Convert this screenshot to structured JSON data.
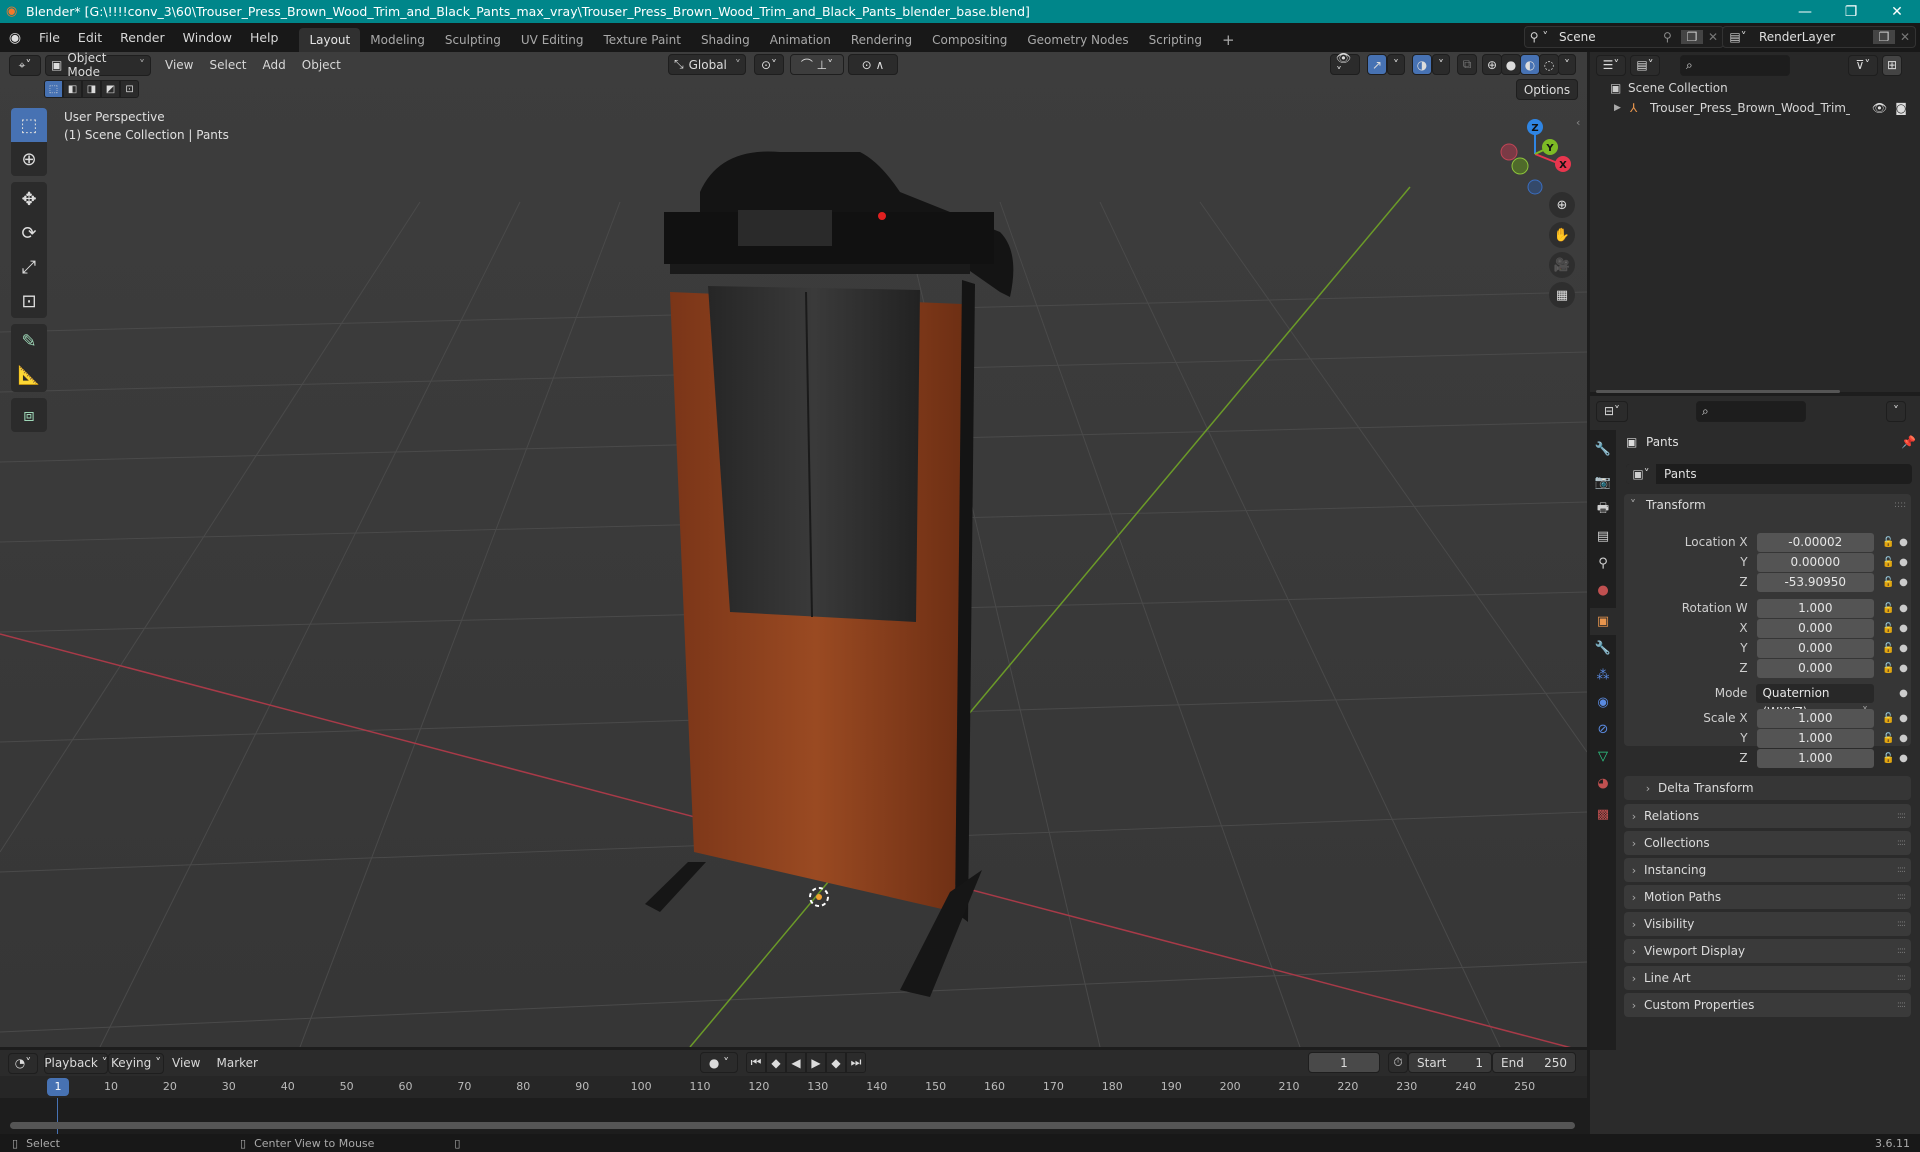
{
  "window": {
    "title": "Blender* [G:\\!!!!conv_3\\60\\Trouser_Press_Brown_Wood_Trim_and_Black_Pants_max_vray\\Trouser_Press_Brown_Wood_Trim_and_Black_Pants_blender_base.blend]",
    "minimize_icon": "—",
    "maximize_icon": "❐",
    "close_icon": "✕"
  },
  "menu": [
    "File",
    "Edit",
    "Render",
    "Window",
    "Help"
  ],
  "workspace_tabs": [
    {
      "label": "Layout",
      "active": true
    },
    {
      "label": "Modeling"
    },
    {
      "label": "Sculpting"
    },
    {
      "label": "UV Editing"
    },
    {
      "label": "Texture Paint"
    },
    {
      "label": "Shading"
    },
    {
      "label": "Animation"
    },
    {
      "label": "Rendering"
    },
    {
      "label": "Compositing"
    },
    {
      "label": "Geometry Nodes"
    },
    {
      "label": "Scripting"
    }
  ],
  "add_workspace": "+",
  "scene_selector": {
    "value": "Scene"
  },
  "view_layer_selector": {
    "value": "RenderLayer"
  },
  "viewport": {
    "mode": "Object Mode",
    "menus": [
      "View",
      "Select",
      "Add",
      "Object"
    ],
    "orientation": "Global",
    "options_label": "Options",
    "overlay_title": "User Perspective",
    "overlay_subtitle": "(1) Scene Collection | Pants",
    "gizmo_axes": {
      "x": "X",
      "y": "Y",
      "z": "Z"
    }
  },
  "colors": {
    "accent_blue": "#4772b3",
    "axis_x": "#e8364e",
    "axis_y": "#7dba25",
    "axis_z": "#2f85e3",
    "titlebar": "#00868a",
    "object_orange": "#e8954d",
    "wood": "#8a3f1c"
  },
  "outliner": {
    "root": "Scene Collection",
    "items": [
      {
        "label": "Trouser_Press_Brown_Wood_Trim_and_I",
        "type": "empty"
      }
    ]
  },
  "properties": {
    "object_name": "Pants",
    "object_field": "Pants",
    "transform": {
      "title": "Transform",
      "location": {
        "label": "Location X",
        "x": "-0.00002",
        "y": "0.00000",
        "z": "-53.90950"
      },
      "rotation": {
        "label": "Rotation W",
        "w": "1.000",
        "x": "0.000",
        "y": "0.000",
        "z": "0.000"
      },
      "mode_label": "Mode",
      "mode": "Quaternion (WXYZ)",
      "scale": {
        "label": "Scale X",
        "x": "1.000",
        "y": "1.000",
        "z": "1.000"
      },
      "axis_labels": {
        "y": "Y",
        "z": "Z",
        "x": "X"
      }
    },
    "delta_transform": "Delta Transform",
    "panels": [
      "Relations",
      "Collections",
      "Instancing",
      "Motion Paths",
      "Visibility",
      "Viewport Display",
      "Line Art",
      "Custom Properties"
    ]
  },
  "timeline": {
    "menus": [
      "Playback",
      "Keying",
      "View",
      "Marker"
    ],
    "current_frame": "1",
    "start_label": "Start",
    "start": "1",
    "end_label": "End",
    "end": "250",
    "ticks": [
      "10",
      "20",
      "30",
      "40",
      "50",
      "60",
      "70",
      "80",
      "90",
      "100",
      "110",
      "120",
      "130",
      "140",
      "150",
      "160",
      "170",
      "180",
      "190",
      "200",
      "210",
      "220",
      "230",
      "240",
      "250"
    ],
    "playhead": "1"
  },
  "statusbar": {
    "select": "Select",
    "center_view": "Center View to Mouse",
    "version": "3.6.11"
  }
}
